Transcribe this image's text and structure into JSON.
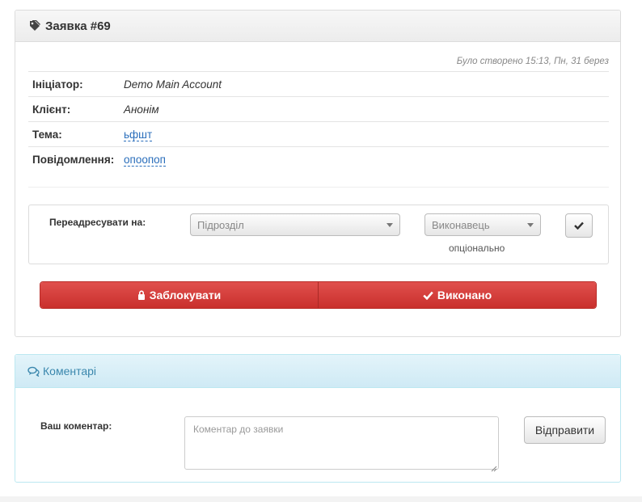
{
  "ticket": {
    "title": "Заявка #69",
    "created": "Було створено 15:13, Пн, 31 берез",
    "fields": [
      {
        "label": "Ініціатор:",
        "value": "Demo Main Account"
      },
      {
        "label": "Клієнт:",
        "value": "Анонім"
      },
      {
        "label": "Тема:",
        "value": "ьфшт"
      },
      {
        "label": "Повідомлення:",
        "value": "опоопоп"
      }
    ],
    "redirect": {
      "label": "Переадресувати на:",
      "department_select": "Підрозділ",
      "executor_select": "Виконавець",
      "executor_note": "опціонально",
      "confirm_icon": "check-icon"
    },
    "actions": {
      "lock_label": "Заблокувати",
      "lock_icon": "lock-icon",
      "done_label": "Виконано",
      "done_icon": "check-icon"
    },
    "title_icon": "tag-icon"
  },
  "comments": {
    "title": "Коментарі",
    "title_icon": "comments-icon",
    "label": "Ваш коментар:",
    "placeholder": "Коментар до заявки",
    "send_label": "Відправити"
  },
  "colors": {
    "danger": "#d9534f",
    "link": "#2a6ebb",
    "info_heading": "#3a87ad"
  }
}
